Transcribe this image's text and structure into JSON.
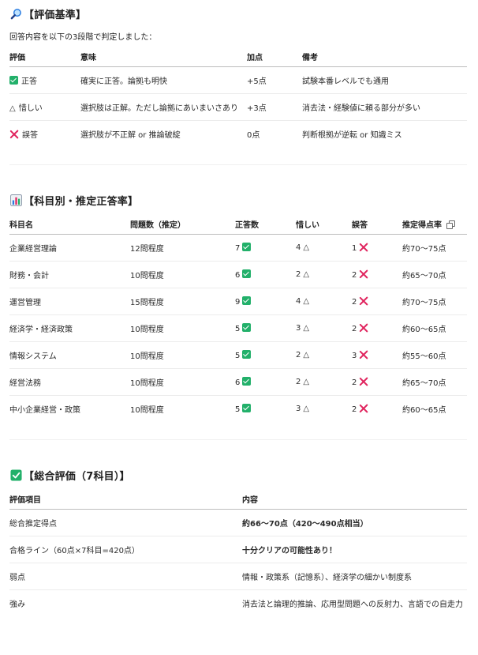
{
  "criteria": {
    "title": "【評価基準】",
    "intro": "回答内容を以下の3段階で判定しました：",
    "headers": [
      "評価",
      "意味",
      "加点",
      "備考"
    ],
    "rows": [
      {
        "mark": "check",
        "label": "正答",
        "meaning": "確実に正答。論拠も明快",
        "points": "+5点",
        "note": "試験本番レベルでも通用"
      },
      {
        "mark": "triangle",
        "label": "惜しい",
        "meaning": "選択肢は正解。ただし論拠にあいまいさあり",
        "points": "+3点",
        "note": "消去法・経験値に頼る部分が多い"
      },
      {
        "mark": "cross",
        "label": "誤答",
        "meaning": "選択肢が不正解 or 推論破綻",
        "points": "0点",
        "note": "判断根拠が逆転 or 知識ミス"
      }
    ]
  },
  "subjects": {
    "title": "【科目別・推定正答率】",
    "headers": [
      "科目名",
      "問題数（推定）",
      "正答数",
      "惜しい",
      "誤答",
      "推定得点率"
    ],
    "triangle_glyph": "△",
    "rows": [
      {
        "name": "企業経営理論",
        "count": "12問程度",
        "correct": "7",
        "close": "4",
        "wrong": "1",
        "rate": "約70〜75点"
      },
      {
        "name": "財務・会計",
        "count": "10問程度",
        "correct": "6",
        "close": "2",
        "wrong": "2",
        "rate": "約65〜70点"
      },
      {
        "name": "運営管理",
        "count": "15問程度",
        "correct": "9",
        "close": "4",
        "wrong": "2",
        "rate": "約70〜75点"
      },
      {
        "name": "経済学・経済政策",
        "count": "10問程度",
        "correct": "5",
        "close": "3",
        "wrong": "2",
        "rate": "約60〜65点"
      },
      {
        "name": "情報システム",
        "count": "10問程度",
        "correct": "5",
        "close": "2",
        "wrong": "3",
        "rate": "約55〜60点"
      },
      {
        "name": "経営法務",
        "count": "10問程度",
        "correct": "6",
        "close": "2",
        "wrong": "2",
        "rate": "約65〜70点"
      },
      {
        "name": "中小企業経営・政策",
        "count": "10問程度",
        "correct": "5",
        "close": "3",
        "wrong": "2",
        "rate": "約60〜65点"
      }
    ]
  },
  "summary": {
    "title": "【総合評価（7科目）】",
    "headers": [
      "評価項目",
      "内容"
    ],
    "rows": [
      {
        "item": "総合推定得点",
        "content": "約66〜70点（420〜490点相当）",
        "bold": true
      },
      {
        "item": "合格ライン（60点×7科目=420点）",
        "content": "十分クリアの可能性あり！",
        "bold": true
      },
      {
        "item": "弱点",
        "content": "情報・政策系（記憶系）、経済学の細かい制度系",
        "bold": false
      },
      {
        "item": "強み",
        "content": "消去法と論理的推論、応用型問題への反射力、言語での自走力",
        "bold": false
      }
    ]
  },
  "icons": {
    "criteria_title": "magnifier-icon",
    "subjects_title": "bar-chart-icon",
    "summary_title": "check-box-icon",
    "rate_header": "copy-icon",
    "colors": {
      "check": "#22b06a",
      "cross": "#e0245e"
    }
  }
}
